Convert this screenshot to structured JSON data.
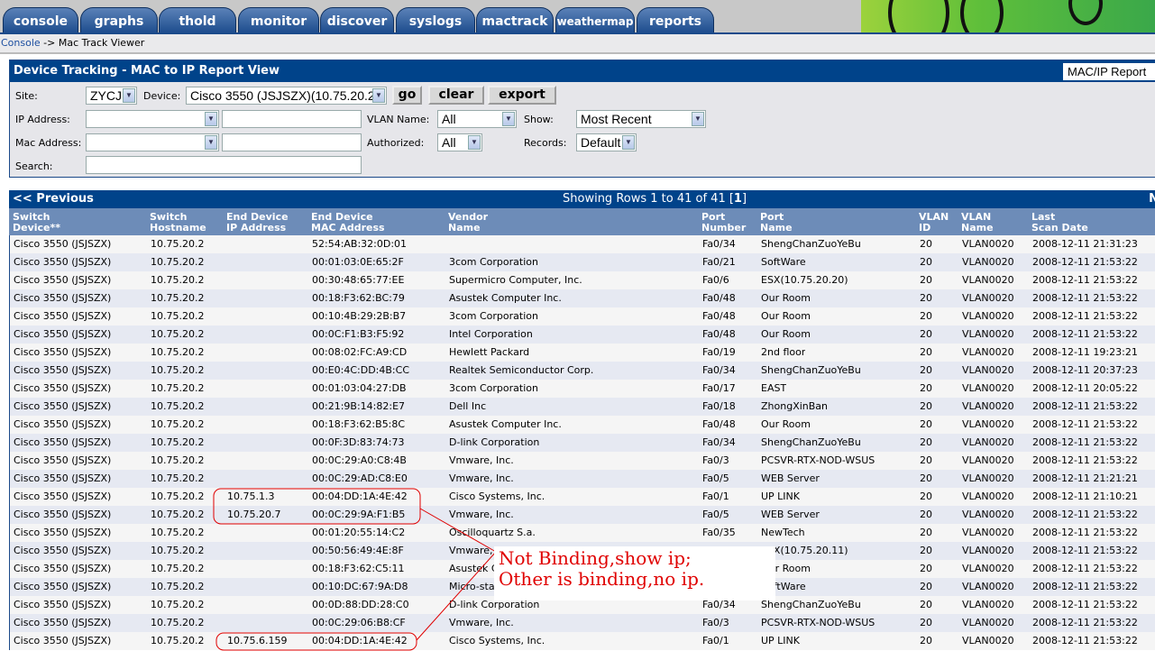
{
  "tabs": [
    "console",
    "graphs",
    "thold",
    "monitor",
    "discover",
    "syslogs",
    "mactrack",
    "weathermap",
    "reports"
  ],
  "breadcrumb": {
    "link": "Console",
    "rest": " -> Mac Track Viewer"
  },
  "filter": {
    "title": "Device Tracking - MAC to IP Report View",
    "report_select": "MAC/IP Report",
    "site_label": "Site:",
    "site_value": "ZYCJ",
    "device_label": "Device:",
    "device_value": "Cisco 3550 (JSJSZX)(10.75.20.2)",
    "go": "go",
    "clear": "clear",
    "export": "export",
    "ip_label": "IP Address:",
    "ip_match": "",
    "ip_value": "",
    "vlan_label": "VLAN Name:",
    "vlan_value": "All",
    "show_label": "Show:",
    "show_value": "Most Recent",
    "mac_label": "Mac Address:",
    "mac_match": "",
    "mac_value": "",
    "auth_label": "Authorized:",
    "auth_value": "All",
    "records_label": "Records:",
    "records_value": "Default",
    "search_label": "Search:",
    "search_value": ""
  },
  "nav": {
    "previous": "<< Previous",
    "showing": "Showing Rows 1 to 41 of 41 [",
    "page": "1",
    "showing_end": "]",
    "next": "N"
  },
  "columns": [
    [
      "Switch",
      "Device**"
    ],
    [
      "Switch",
      "Hostname"
    ],
    [
      "End Device",
      "IP Address"
    ],
    [
      "End Device",
      "MAC Address"
    ],
    [
      "Vendor",
      "Name"
    ],
    [
      "Port",
      "Number"
    ],
    [
      "Port",
      "Name"
    ],
    [
      "VLAN",
      "ID"
    ],
    [
      "VLAN",
      "Name"
    ],
    [
      "Last",
      "Scan Date"
    ]
  ],
  "rows": [
    [
      "Cisco 3550 (JSJSZX)",
      "10.75.20.2",
      "",
      "52:54:AB:32:0D:01",
      "",
      "Fa0/34",
      "ShengChanZuoYeBu",
      "20",
      "VLAN0020",
      "2008-12-11 21:31:23"
    ],
    [
      "Cisco 3550 (JSJSZX)",
      "10.75.20.2",
      "",
      "00:01:03:0E:65:2F",
      "3com Corporation",
      "Fa0/21",
      "SoftWare",
      "20",
      "VLAN0020",
      "2008-12-11 21:53:22"
    ],
    [
      "Cisco 3550 (JSJSZX)",
      "10.75.20.2",
      "",
      "00:30:48:65:77:EE",
      "Supermicro Computer, Inc.",
      "Fa0/6",
      "ESX(10.75.20.20)",
      "20",
      "VLAN0020",
      "2008-12-11 21:53:22"
    ],
    [
      "Cisco 3550 (JSJSZX)",
      "10.75.20.2",
      "",
      "00:18:F3:62:BC:79",
      "Asustek Computer Inc.",
      "Fa0/48",
      "Our Room",
      "20",
      "VLAN0020",
      "2008-12-11 21:53:22"
    ],
    [
      "Cisco 3550 (JSJSZX)",
      "10.75.20.2",
      "",
      "00:10:4B:29:2B:B7",
      "3com Corporation",
      "Fa0/48",
      "Our Room",
      "20",
      "VLAN0020",
      "2008-12-11 21:53:22"
    ],
    [
      "Cisco 3550 (JSJSZX)",
      "10.75.20.2",
      "",
      "00:0C:F1:B3:F5:92",
      "Intel Corporation",
      "Fa0/48",
      "Our Room",
      "20",
      "VLAN0020",
      "2008-12-11 21:53:22"
    ],
    [
      "Cisco 3550 (JSJSZX)",
      "10.75.20.2",
      "",
      "00:08:02:FC:A9:CD",
      "Hewlett Packard",
      "Fa0/19",
      "2nd floor",
      "20",
      "VLAN0020",
      "2008-12-11 19:23:21"
    ],
    [
      "Cisco 3550 (JSJSZX)",
      "10.75.20.2",
      "",
      "00:E0:4C:DD:4B:CC",
      "Realtek Semiconductor Corp.",
      "Fa0/34",
      "ShengChanZuoYeBu",
      "20",
      "VLAN0020",
      "2008-12-11 20:37:23"
    ],
    [
      "Cisco 3550 (JSJSZX)",
      "10.75.20.2",
      "",
      "00:01:03:04:27:DB",
      "3com Corporation",
      "Fa0/17",
      "EAST",
      "20",
      "VLAN0020",
      "2008-12-11 20:05:22"
    ],
    [
      "Cisco 3550 (JSJSZX)",
      "10.75.20.2",
      "",
      "00:21:9B:14:82:E7",
      "Dell Inc",
      "Fa0/18",
      "ZhongXinBan",
      "20",
      "VLAN0020",
      "2008-12-11 21:53:22"
    ],
    [
      "Cisco 3550 (JSJSZX)",
      "10.75.20.2",
      "",
      "00:18:F3:62:B5:8C",
      "Asustek Computer Inc.",
      "Fa0/48",
      "Our Room",
      "20",
      "VLAN0020",
      "2008-12-11 21:53:22"
    ],
    [
      "Cisco 3550 (JSJSZX)",
      "10.75.20.2",
      "",
      "00:0F:3D:83:74:73",
      "D-link Corporation",
      "Fa0/34",
      "ShengChanZuoYeBu",
      "20",
      "VLAN0020",
      "2008-12-11 21:53:22"
    ],
    [
      "Cisco 3550 (JSJSZX)",
      "10.75.20.2",
      "",
      "00:0C:29:A0:C8:4B",
      "Vmware, Inc.",
      "Fa0/3",
      "PCSVR-RTX-NOD-WSUS",
      "20",
      "VLAN0020",
      "2008-12-11 21:53:22"
    ],
    [
      "Cisco 3550 (JSJSZX)",
      "10.75.20.2",
      "",
      "00:0C:29:AD:C8:E0",
      "Vmware, Inc.",
      "Fa0/5",
      "WEB Server",
      "20",
      "VLAN0020",
      "2008-12-11 21:21:21"
    ],
    [
      "Cisco 3550 (JSJSZX)",
      "10.75.20.2",
      "10.75.1.3",
      "00:04:DD:1A:4E:42",
      "Cisco Systems, Inc.",
      "Fa0/1",
      "UP LINK",
      "20",
      "VLAN0020",
      "2008-12-11 21:10:21"
    ],
    [
      "Cisco 3550 (JSJSZX)",
      "10.75.20.2",
      "10.75.20.7",
      "00:0C:29:9A:F1:B5",
      "Vmware, Inc.",
      "Fa0/5",
      "WEB Server",
      "20",
      "VLAN0020",
      "2008-12-11 21:53:22"
    ],
    [
      "Cisco 3550 (JSJSZX)",
      "10.75.20.2",
      "",
      "00:01:20:55:14:C2",
      "Oscilloquartz S.a.",
      "Fa0/35",
      "NewTech",
      "20",
      "VLAN0020",
      "2008-12-11 21:53:22"
    ],
    [
      "Cisco 3550 (JSJSZX)",
      "10.75.20.2",
      "",
      "00:50:56:49:4E:8F",
      "Vmware, Inc.",
      "",
      "ESX(10.75.20.11)",
      "20",
      "VLAN0020",
      "2008-12-11 21:53:22"
    ],
    [
      "Cisco 3550 (JSJSZX)",
      "10.75.20.2",
      "",
      "00:18:F3:62:C5:11",
      "Asustek Computer Inc.",
      "",
      "Our Room",
      "20",
      "VLAN0020",
      "2008-12-11 21:53:22"
    ],
    [
      "Cisco 3550 (JSJSZX)",
      "10.75.20.2",
      "",
      "00:10:DC:67:9A:D8",
      "Micro-star",
      "",
      "SoftWare",
      "20",
      "VLAN0020",
      "2008-12-11 21:53:22"
    ],
    [
      "Cisco 3550 (JSJSZX)",
      "10.75.20.2",
      "",
      "00:0D:88:DD:28:C0",
      "D-link Corporation",
      "Fa0/34",
      "ShengChanZuoYeBu",
      "20",
      "VLAN0020",
      "2008-12-11 21:53:22"
    ],
    [
      "Cisco 3550 (JSJSZX)",
      "10.75.20.2",
      "",
      "00:0C:29:06:B8:CF",
      "Vmware, Inc.",
      "Fa0/3",
      "PCSVR-RTX-NOD-WSUS",
      "20",
      "VLAN0020",
      "2008-12-11 21:53:22"
    ],
    [
      "Cisco 3550 (JSJSZX)",
      "10.75.20.2",
      "10.75.6.159",
      "00:04:DD:1A:4E:42",
      "Cisco Systems, Inc.",
      "Fa0/1",
      "UP LINK",
      "20",
      "VLAN0020",
      "2008-12-11 21:53:22"
    ]
  ],
  "annotation": {
    "line1": "Not Binding,show ip;",
    "line2": "Other is binding,no ip.",
    "color": "#e00000"
  }
}
